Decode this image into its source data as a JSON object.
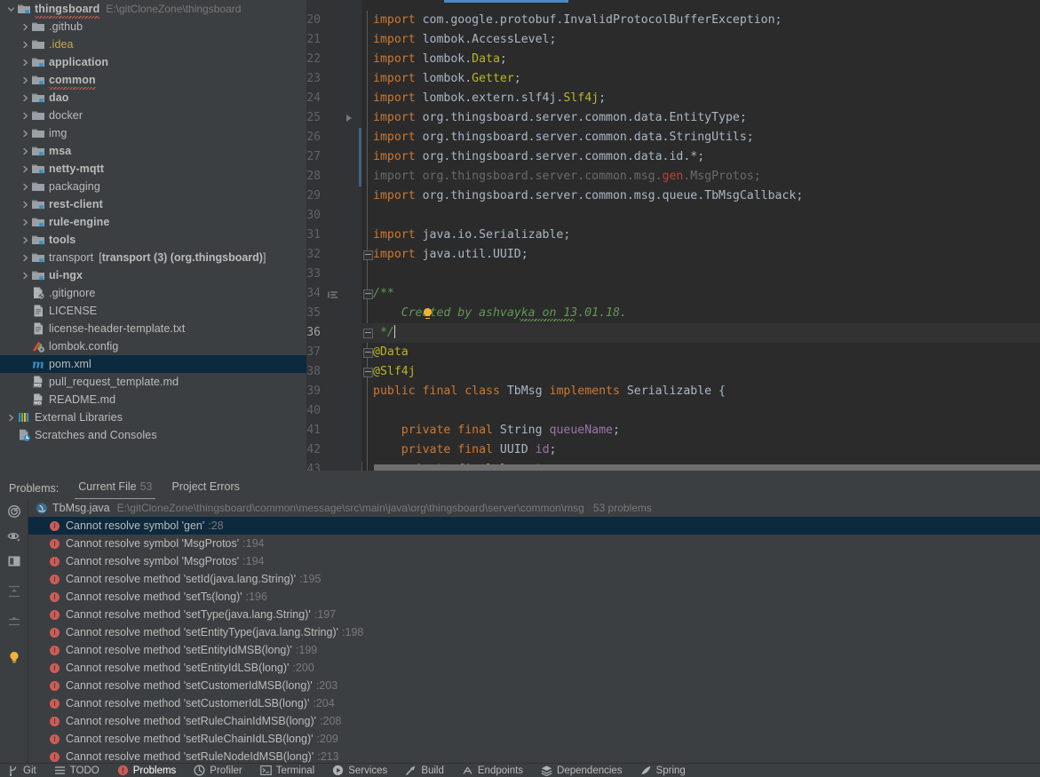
{
  "project_tree": {
    "root": {
      "label": "thingsboard",
      "path": "E:\\gitCloneZone\\thingsboard"
    },
    "items": [
      {
        "label": ".github",
        "type": "folder",
        "indent": 1,
        "style": "plain"
      },
      {
        "label": ".idea",
        "type": "folder",
        "indent": 1,
        "style": "yellow"
      },
      {
        "label": "application",
        "type": "module-folder",
        "indent": 1,
        "style": "bold"
      },
      {
        "label": "common",
        "type": "module-folder",
        "indent": 1,
        "style": "bold"
      },
      {
        "label": "dao",
        "type": "module-folder",
        "indent": 1,
        "style": "bold"
      },
      {
        "label": "docker",
        "type": "folder",
        "indent": 1,
        "style": "plain"
      },
      {
        "label": "img",
        "type": "folder",
        "indent": 1,
        "style": "plain"
      },
      {
        "label": "msa",
        "type": "module-folder",
        "indent": 1,
        "style": "bold"
      },
      {
        "label": "netty-mqtt",
        "type": "module-folder",
        "indent": 1,
        "style": "bold"
      },
      {
        "label": "packaging",
        "type": "folder",
        "indent": 1,
        "style": "plain"
      },
      {
        "label": "rest-client",
        "type": "module-folder",
        "indent": 1,
        "style": "bold"
      },
      {
        "label": "rule-engine",
        "type": "module-folder",
        "indent": 1,
        "style": "bold"
      },
      {
        "label": "tools",
        "type": "module-folder",
        "indent": 1,
        "style": "bold"
      },
      {
        "label": "transport",
        "type": "module-folder",
        "indent": 1,
        "style": "plain",
        "suffix": "[transport (3) (org.thingsboard)]"
      },
      {
        "label": "ui-ngx",
        "type": "module-folder",
        "indent": 1,
        "style": "bold"
      },
      {
        "label": ".gitignore",
        "type": "gitignore-file",
        "indent": 1,
        "style": "plain"
      },
      {
        "label": "LICENSE",
        "type": "text-file",
        "indent": 1,
        "style": "plain"
      },
      {
        "label": "license-header-template.txt",
        "type": "text-file",
        "indent": 1,
        "style": "plain"
      },
      {
        "label": "lombok.config",
        "type": "lombok-file",
        "indent": 1,
        "style": "plain"
      },
      {
        "label": "pom.xml",
        "type": "maven-file",
        "indent": 1,
        "style": "plain",
        "selected": true
      },
      {
        "label": "pull_request_template.md",
        "type": "markdown-file",
        "indent": 1,
        "style": "plain"
      },
      {
        "label": "README.md",
        "type": "markdown-file",
        "indent": 1,
        "style": "plain"
      },
      {
        "label": "External Libraries",
        "type": "libraries",
        "indent": 0,
        "style": "plain",
        "expandable": true
      },
      {
        "label": "Scratches and Consoles",
        "type": "scratches",
        "indent": 0,
        "style": "plain"
      }
    ]
  },
  "editor": {
    "current_line": 36,
    "first_line": 20,
    "lines": [
      {
        "n": 20,
        "segments": [
          {
            "t": "import ",
            "c": "kw"
          },
          {
            "t": "com.google.protobuf.InvalidProtocolBufferException;",
            "c": "id"
          }
        ]
      },
      {
        "n": 21,
        "segments": [
          {
            "t": "import ",
            "c": "kw"
          },
          {
            "t": "lombok.AccessLevel;",
            "c": "id"
          }
        ]
      },
      {
        "n": 22,
        "segments": [
          {
            "t": "import ",
            "c": "kw"
          },
          {
            "t": "lombok.",
            "c": "id"
          },
          {
            "t": "Data",
            "c": "ann"
          },
          {
            "t": ";",
            "c": "id"
          }
        ]
      },
      {
        "n": 23,
        "segments": [
          {
            "t": "import ",
            "c": "kw"
          },
          {
            "t": "lombok.",
            "c": "id"
          },
          {
            "t": "Getter",
            "c": "ann"
          },
          {
            "t": ";",
            "c": "id"
          }
        ]
      },
      {
        "n": 24,
        "segments": [
          {
            "t": "import ",
            "c": "kw"
          },
          {
            "t": "lombok.extern.slf4j.",
            "c": "id"
          },
          {
            "t": "Slf4j",
            "c": "ann"
          },
          {
            "t": ";",
            "c": "id"
          }
        ]
      },
      {
        "n": 25,
        "segments": [
          {
            "t": "import ",
            "c": "kw"
          },
          {
            "t": "org.thingsboard.server.common.data.EntityType;",
            "c": "id"
          }
        ]
      },
      {
        "n": 26,
        "segments": [
          {
            "t": "import ",
            "c": "kw"
          },
          {
            "t": "org.thingsboard.server.common.data.StringUtils;",
            "c": "id"
          }
        ]
      },
      {
        "n": 27,
        "segments": [
          {
            "t": "import ",
            "c": "kw"
          },
          {
            "t": "org.thingsboard.server.common.data.id.*;",
            "c": "id"
          }
        ]
      },
      {
        "n": 28,
        "segments": [
          {
            "t": "import ",
            "c": "dim"
          },
          {
            "t": "org.thingsboard.server.common.msg.",
            "c": "dim"
          },
          {
            "t": "gen",
            "c": "err"
          },
          {
            "t": ".MsgProtos;",
            "c": "dim"
          }
        ]
      },
      {
        "n": 29,
        "segments": [
          {
            "t": "import ",
            "c": "kw"
          },
          {
            "t": "org.thingsboard.server.common.msg.queue.TbMsgCallback;",
            "c": "id"
          }
        ]
      },
      {
        "n": 30,
        "segments": []
      },
      {
        "n": 31,
        "segments": [
          {
            "t": "import ",
            "c": "kw"
          },
          {
            "t": "java.io.Serializable;",
            "c": "id"
          }
        ]
      },
      {
        "n": 32,
        "segments": [
          {
            "t": "import ",
            "c": "kw"
          },
          {
            "t": "java.util.UUID;",
            "c": "id"
          }
        ]
      },
      {
        "n": 33,
        "segments": []
      },
      {
        "n": 34,
        "segments": [
          {
            "t": "/**",
            "c": "cmt"
          }
        ]
      },
      {
        "n": 35,
        "segments": [
          {
            "t": "    Created by ashvayka on 13.01.18.",
            "c": "cmt"
          }
        ]
      },
      {
        "n": 36,
        "segments": [
          {
            "t": " */",
            "c": "cmt"
          }
        ]
      },
      {
        "n": 37,
        "segments": [
          {
            "t": "@Data",
            "c": "ann"
          }
        ]
      },
      {
        "n": 38,
        "segments": [
          {
            "t": "@Slf4j",
            "c": "ann"
          }
        ]
      },
      {
        "n": 39,
        "segments": [
          {
            "t": "public final class ",
            "c": "kw"
          },
          {
            "t": "TbMsg ",
            "c": "id"
          },
          {
            "t": "implements ",
            "c": "kw"
          },
          {
            "t": "Serializable {",
            "c": "id"
          }
        ]
      },
      {
        "n": 40,
        "segments": []
      },
      {
        "n": 41,
        "segments": [
          {
            "t": "    private final ",
            "c": "kw"
          },
          {
            "t": "String ",
            "c": "id"
          },
          {
            "t": "queueName",
            "c": "fld"
          },
          {
            "t": ";",
            "c": "id"
          }
        ]
      },
      {
        "n": 42,
        "segments": [
          {
            "t": "    private final ",
            "c": "kw"
          },
          {
            "t": "UUID ",
            "c": "id"
          },
          {
            "t": "id",
            "c": "fld"
          },
          {
            "t": ";",
            "c": "id"
          }
        ]
      },
      {
        "n": 43,
        "segments": [
          {
            "t": "    private final long ",
            "c": "kw"
          },
          {
            "t": "ts",
            "c": "fld"
          },
          {
            "t": ";",
            "c": "id"
          }
        ]
      }
    ]
  },
  "problems": {
    "title": "Problems:",
    "tabs": [
      {
        "label": "Current File",
        "count": "53",
        "active": true
      },
      {
        "label": "Project Errors",
        "count": "",
        "active": false
      }
    ],
    "file": {
      "name": "TbMsg.java",
      "path": "E:\\gitCloneZone\\thingsboard\\common\\message\\src\\main\\java\\org\\thingsboard\\server\\common\\msg",
      "count": "53 problems"
    },
    "toolbar_icons": [
      "inspections-icon",
      "autoscroll-eye-icon",
      "view-layout-icon",
      "expand-all-icon",
      "collapse-all-icon",
      "lightbulb-icon"
    ],
    "items": [
      {
        "text": "Cannot resolve symbol 'gen'",
        "line": ":28",
        "selected": true
      },
      {
        "text": "Cannot resolve symbol 'MsgProtos'",
        "line": ":194"
      },
      {
        "text": "Cannot resolve symbol 'MsgProtos'",
        "line": ":194"
      },
      {
        "text": "Cannot resolve method 'setId(java.lang.String)'",
        "line": ":195"
      },
      {
        "text": "Cannot resolve method 'setTs(long)'",
        "line": ":196"
      },
      {
        "text": "Cannot resolve method 'setType(java.lang.String)'",
        "line": ":197"
      },
      {
        "text": "Cannot resolve method 'setEntityType(java.lang.String)'",
        "line": ":198"
      },
      {
        "text": "Cannot resolve method 'setEntityIdMSB(long)'",
        "line": ":199"
      },
      {
        "text": "Cannot resolve method 'setEntityIdLSB(long)'",
        "line": ":200"
      },
      {
        "text": "Cannot resolve method 'setCustomerIdMSB(long)'",
        "line": ":203"
      },
      {
        "text": "Cannot resolve method 'setCustomerIdLSB(long)'",
        "line": ":204"
      },
      {
        "text": "Cannot resolve method 'setRuleChainIdMSB(long)'",
        "line": ":208"
      },
      {
        "text": "Cannot resolve method 'setRuleChainIdLSB(long)'",
        "line": ":209"
      },
      {
        "text": "Cannot resolve method 'setRuleNodeIdMSB(long)'",
        "line": ":213"
      }
    ]
  },
  "bottom_toolbar": {
    "buttons": [
      {
        "label": "Git",
        "icon": "git-branch-icon",
        "active": false
      },
      {
        "label": "TODO",
        "icon": "todo-list-icon",
        "active": false
      },
      {
        "label": "Problems",
        "icon": "problems-error-icon",
        "active": true
      },
      {
        "label": "Profiler",
        "icon": "profiler-icon",
        "active": false
      },
      {
        "label": "Terminal",
        "icon": "terminal-icon",
        "active": false
      },
      {
        "label": "Services",
        "icon": "services-play-icon",
        "active": false
      },
      {
        "label": "Build",
        "icon": "build-hammer-icon",
        "active": false
      },
      {
        "label": "Endpoints",
        "icon": "endpoints-icon",
        "active": false
      },
      {
        "label": "Dependencies",
        "icon": "dependencies-icon",
        "active": false
      },
      {
        "label": "Spring",
        "icon": "spring-leaf-icon",
        "active": false
      }
    ]
  },
  "colors": {
    "panel_bg": "#3c3f41",
    "editor_bg": "#2b2b2b",
    "gutter_bg": "#313335",
    "selection_bg": "#0d293e",
    "accent_blue": "#4a88c7",
    "error_red": "#cf5b56",
    "comment_green": "#629755",
    "keyword_orange": "#cc7832",
    "annotation_yellow": "#bbb529"
  }
}
